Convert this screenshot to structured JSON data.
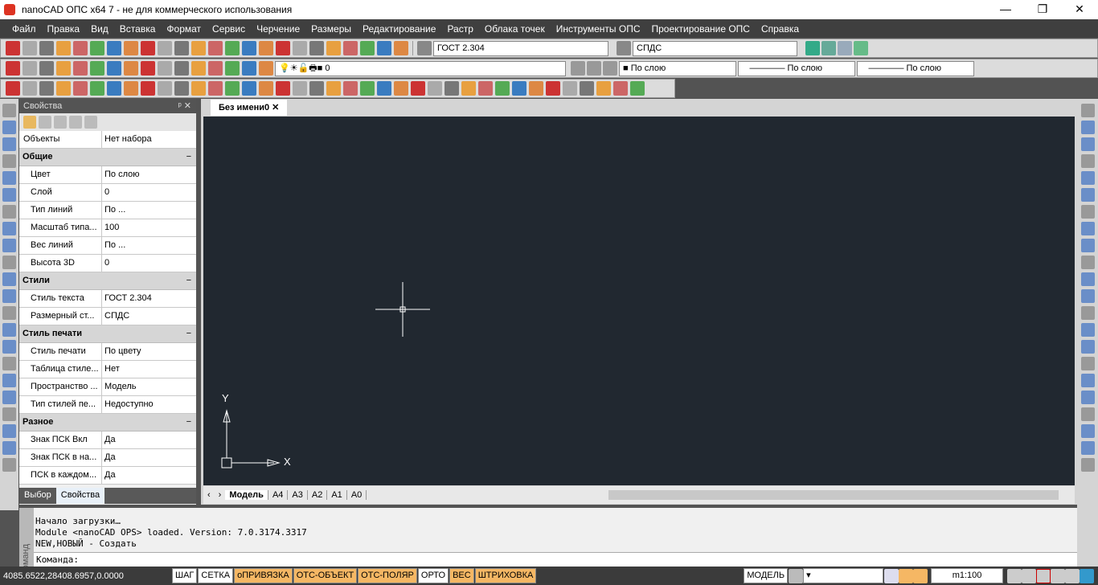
{
  "window": {
    "title": "nanoCAD ОПС x64 7 - не для коммерческого использования",
    "minimize": "—",
    "maximize": "❐",
    "close": "✕"
  },
  "menu": [
    "Файл",
    "Правка",
    "Вид",
    "Вставка",
    "Формат",
    "Сервис",
    "Черчение",
    "Размеры",
    "Редактирование",
    "Растр",
    "Облака точек",
    "Инструменты ОПС",
    "Проектирование ОПС",
    "Справка"
  ],
  "toolbar": {
    "text_style": "ГОСТ 2.304",
    "dim_style": "СПДС",
    "layer": "0",
    "color": "По слою",
    "linetype": "По слою",
    "lineweight": "По слою"
  },
  "properties": {
    "title": "Свойства",
    "objects_label": "Объекты",
    "objects_value": "Нет набора",
    "categories": [
      {
        "name": "Общие",
        "rows": [
          {
            "k": "Цвет",
            "v": "По слою"
          },
          {
            "k": "Слой",
            "v": "0"
          },
          {
            "k": "Тип линий",
            "v": "По ..."
          },
          {
            "k": "Масштаб типа...",
            "v": "100"
          },
          {
            "k": "Вес линий",
            "v": "По ..."
          },
          {
            "k": "Высота 3D",
            "v": "0"
          }
        ]
      },
      {
        "name": "Стили",
        "rows": [
          {
            "k": "Стиль текста",
            "v": "ГОСТ 2.304"
          },
          {
            "k": "Размерный ст...",
            "v": "СПДС"
          }
        ]
      },
      {
        "name": "Стиль печати",
        "rows": [
          {
            "k": "Стиль печати",
            "v": "По цвету"
          },
          {
            "k": "Таблица стиле...",
            "v": "Нет"
          },
          {
            "k": "Пространство ...",
            "v": "Модель"
          },
          {
            "k": "Тип стилей пе...",
            "v": "Недоступно"
          }
        ]
      },
      {
        "name": "Разное",
        "rows": [
          {
            "k": "Знак ПСК Вкл",
            "v": "Да"
          },
          {
            "k": "Знак ПСК в на...",
            "v": "Да"
          },
          {
            "k": "ПСК в каждом...",
            "v": "Да"
          }
        ]
      }
    ],
    "tabs": [
      "Выбор",
      "Свойства"
    ]
  },
  "document": {
    "tab": "Без имени0",
    "layout_tabs": [
      "Модель",
      "A4",
      "A3",
      "A2",
      "A1",
      "A0"
    ],
    "ucs_x": "X",
    "ucs_y": "Y"
  },
  "command": {
    "side_label": "Команд",
    "lines": [
      "Начало загрузки…",
      "Module <nanoCAD OPS> loaded. Version: 7.0.3174.3317",
      "NEW,НОВЫЙ - Создать"
    ],
    "prompt": "Команда:"
  },
  "status": {
    "coords": "4085.6522,28408.6957,0.0000",
    "toggles": [
      {
        "label": "ШАГ",
        "on": false
      },
      {
        "label": "СЕТКА",
        "on": false
      },
      {
        "label": "оПРИВЯЗКА",
        "on": true
      },
      {
        "label": "ОТС-ОБЪЕКТ",
        "on": true
      },
      {
        "label": "ОТС-ПОЛЯР",
        "on": true
      },
      {
        "label": "ОРТО",
        "on": false
      },
      {
        "label": "ВЕС",
        "on": true
      },
      {
        "label": "ШТРИХОВКА",
        "on": true
      }
    ],
    "space": "МОДЕЛЬ",
    "scale": "m1:100"
  }
}
